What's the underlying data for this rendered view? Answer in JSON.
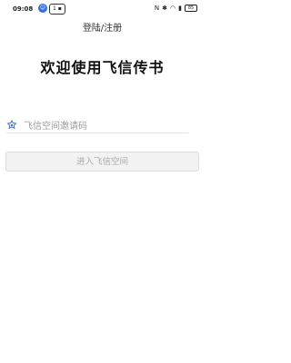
{
  "status_bar": {
    "time": "09:08",
    "badge_icon": "user-badge-icon",
    "notification_count": "1",
    "notification_icon": "app-notification-icon",
    "icons": [
      "nfc-icon",
      "bluetooth-icon",
      "wifi-icon",
      "signal-icon",
      "battery-icon"
    ],
    "battery": "85"
  },
  "header": {
    "login_register": "登陆/注册"
  },
  "main": {
    "title": "欢迎使用飞信传书",
    "invite_icon": "invite-code-icon",
    "invite_placeholder": "飞信空间邀请码",
    "enter_button": "进入飞信空间",
    "accent_color": "#2f6fe4"
  }
}
